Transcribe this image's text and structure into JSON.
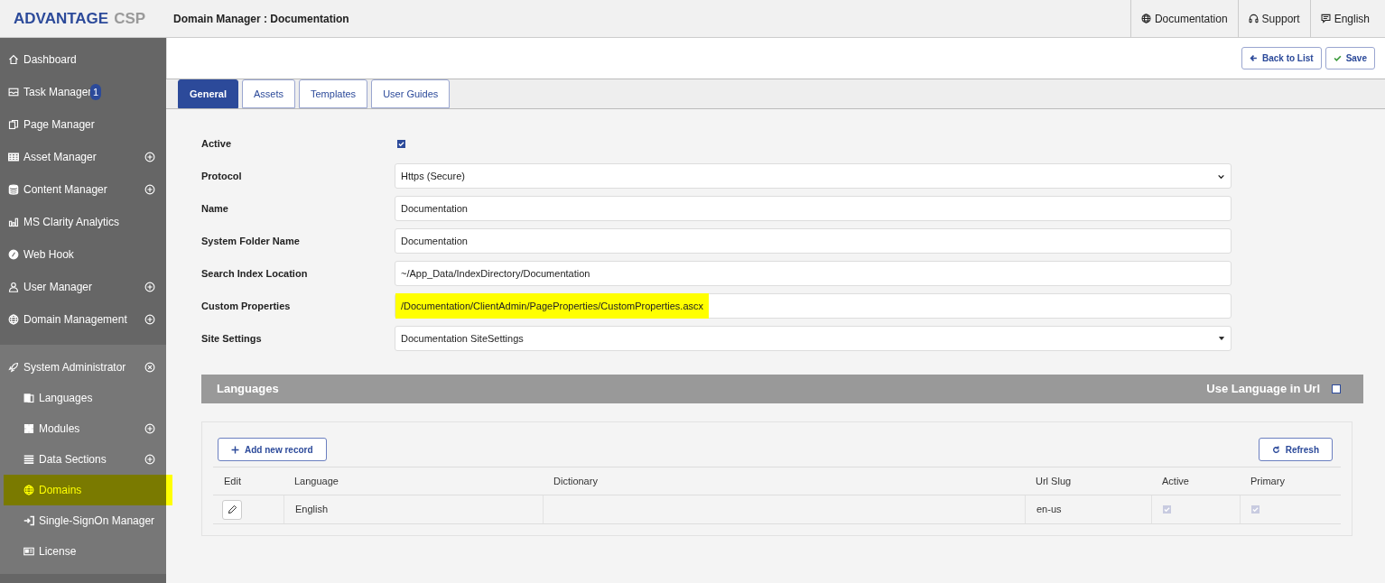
{
  "header": {
    "logo_main": "ADVANTAGE",
    "logo_sub": "CSP",
    "title": "Domain Manager : Documentation",
    "links": [
      "Documentation",
      "Support",
      "English"
    ]
  },
  "sidebar": {
    "items": [
      {
        "label": "Dashboard",
        "selected": false
      },
      {
        "label": "Task Manager",
        "selected": false,
        "badge": "1"
      },
      {
        "label": "Page Manager",
        "selected": false
      },
      {
        "label": "Asset Manager",
        "selected": false,
        "expanded": false
      },
      {
        "label": "Content Manager",
        "selected": false,
        "expanded": false
      },
      {
        "label": "MS Clarity Analytics",
        "selected": false
      },
      {
        "label": "Web Hook",
        "selected": false
      },
      {
        "label": "User Manager",
        "selected": false,
        "expanded": false
      },
      {
        "label": "Domain Management",
        "selected": false,
        "expanded": false
      },
      {
        "label": "System Administrator",
        "selected": false,
        "expanded": true,
        "children": [
          {
            "label": "Languages",
            "selected": false
          },
          {
            "label": "Modules",
            "selected": false,
            "expanded": false
          },
          {
            "label": "Data Sections",
            "selected": false,
            "expanded": false
          },
          {
            "label": "Domains",
            "selected": true
          },
          {
            "label": "Single-SignOn Manager",
            "selected": false
          },
          {
            "label": "License",
            "selected": false
          }
        ]
      }
    ]
  },
  "actions": [
    "Back to List",
    "Save"
  ],
  "tabs": [
    {
      "label": "General",
      "selected": true
    },
    {
      "label": "Assets",
      "selected": false
    },
    {
      "label": "Templates",
      "selected": false
    },
    {
      "label": "User Guides",
      "selected": false
    }
  ],
  "form": [
    {
      "label": "Active",
      "kind": "checkbox",
      "checked": true
    },
    {
      "label": "Protocol",
      "kind": "select",
      "value": "Https (Secure)"
    },
    {
      "label": "Name",
      "kind": "text",
      "value": "Documentation"
    },
    {
      "label": "System Folder Name",
      "kind": "text",
      "value": "Documentation"
    },
    {
      "label": "Search Index Location",
      "kind": "text",
      "value": "~/App_Data/IndexDirectory/Documentation"
    },
    {
      "label": "Custom Properties",
      "kind": "text",
      "value": "/Documentation/ClientAdmin/PageProperties/CustomProperties.ascx",
      "highlighted": true
    },
    {
      "label": "Site Settings",
      "kind": "dropdown",
      "value": "Documentation SiteSettings"
    }
  ],
  "languages": {
    "title": "Languages",
    "toggle_label": "Use Language in Url",
    "toggle_checked": false,
    "add_button": "Add new record",
    "refresh_button": "Refresh",
    "columns": [
      "Edit",
      "Language",
      "Dictionary",
      "Url Slug",
      "Active",
      "Primary"
    ],
    "rows": [
      {
        "language": "English",
        "dictionary": "",
        "url_slug": "en-us",
        "active": true,
        "primary": true
      }
    ]
  }
}
